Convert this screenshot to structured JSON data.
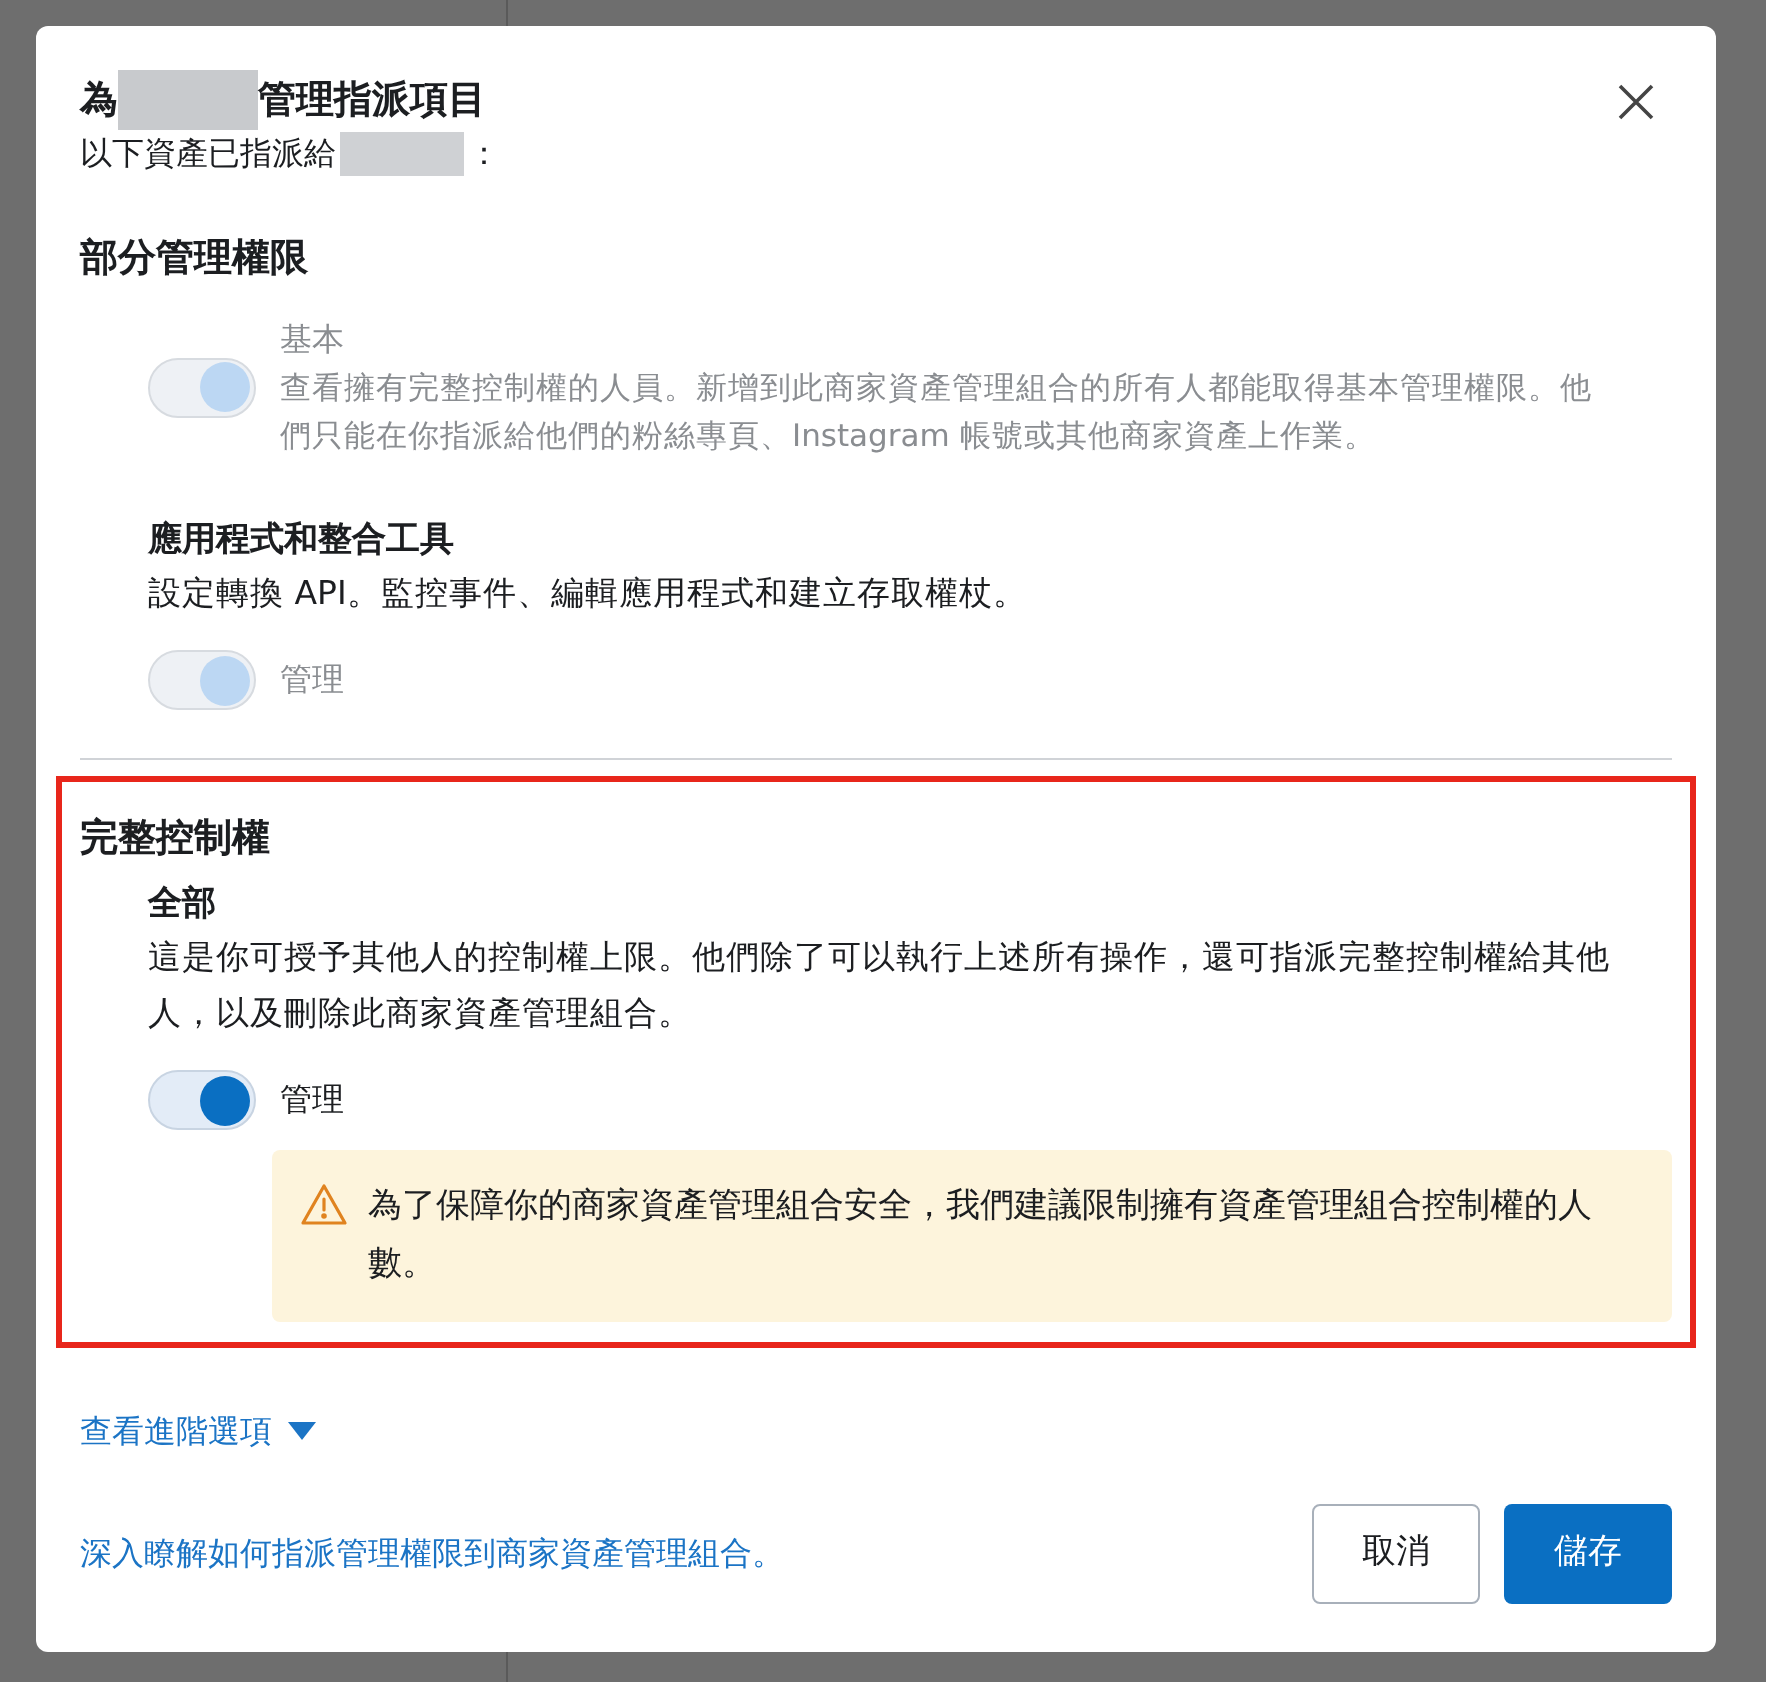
{
  "dialog": {
    "title_prefix": "為",
    "title_suffix": "管理指派項目",
    "subtitle": "以下資產已指派給",
    "subtitle_suffix": "："
  },
  "sections": [
    {
      "heading": "部分管理權限",
      "highlighted": false,
      "items": [
        {
          "name": "基本",
          "kind": "inline",
          "description": "查看擁有完整控制權的人員。新增到此商家資產管理組合的所有人都能取得基本管理權限。他們只能在你指派給他們的粉絲專頁、Instagram 帳號或其他商家資產上作業。",
          "toggle": {
            "on": true,
            "disabled": true
          }
        },
        {
          "name": "應用程式和整合工具",
          "kind": "stacked",
          "description": "設定轉換 API。監控事件、編輯應用程式和建立存取權杖。",
          "toggle": {
            "on": true,
            "disabled": true,
            "label": "管理"
          }
        }
      ]
    },
    {
      "heading": "完整控制權",
      "highlighted": true,
      "items": [
        {
          "name": "全部",
          "kind": "stacked",
          "description": "這是你可授予其他人的控制權上限。他們除了可以執行上述所有操作，還可指派完整控制權給其他人，以及刪除此商家資產管理組合。",
          "toggle": {
            "on": true,
            "disabled": false,
            "label": "管理"
          },
          "warning": "為了保障你的商家資產管理組合安全，我們建議限制擁有資產管理組合控制權的人數。"
        }
      ]
    }
  ],
  "advanced_link": {
    "label": "查看進階選項",
    "expanded": false
  },
  "footer": {
    "help_link": "深入瞭解如何指派管理權限到商家資產管理組合。",
    "buttons": [
      {
        "label": "取消",
        "kind": "secondary"
      },
      {
        "label": "儲存",
        "kind": "primary"
      }
    ]
  }
}
